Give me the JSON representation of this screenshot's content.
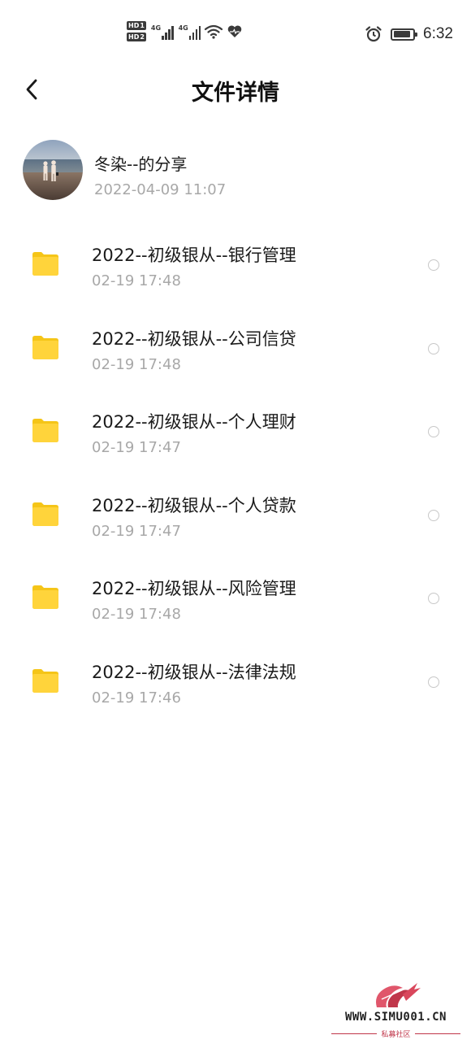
{
  "status_bar": {
    "sim1_badge": "HD",
    "sim1_num": "1",
    "sim2_badge": "HD",
    "sim2_num": "2",
    "net1": "4G",
    "net2": "4G",
    "battery_level": 0.9,
    "time": "6:32",
    "icons": [
      "signal-icon",
      "wifi-icon",
      "heart-icon",
      "alarm-icon",
      "battery-icon"
    ]
  },
  "header": {
    "title": "文件详情",
    "back_icon": "chevron-left-icon"
  },
  "owner": {
    "name": "冬染--的分享",
    "time": "2022-04-09  11:07"
  },
  "files": [
    {
      "name": "2022--初级银从--银行管理",
      "time": "02-19  17:48"
    },
    {
      "name": "2022--初级银从--公司信贷",
      "time": "02-19  17:48"
    },
    {
      "name": "2022--初级银从--个人理财",
      "time": "02-19  17:47"
    },
    {
      "name": "2022--初级银从--个人贷款",
      "time": "02-19  17:47"
    },
    {
      "name": "2022--初级银从--风险管理",
      "time": "02-19  17:48"
    },
    {
      "name": "2022--初级银从--法律法规",
      "time": "02-19  17:46"
    }
  ],
  "watermark": {
    "site": "WWW.SIMU001.CN",
    "subtitle": "私募社区"
  },
  "colors": {
    "folder": "#FFD43B",
    "folder_tab": "#F5C518",
    "secondary_text": "#A8A8A8",
    "watermark_red": "#C0364A"
  }
}
